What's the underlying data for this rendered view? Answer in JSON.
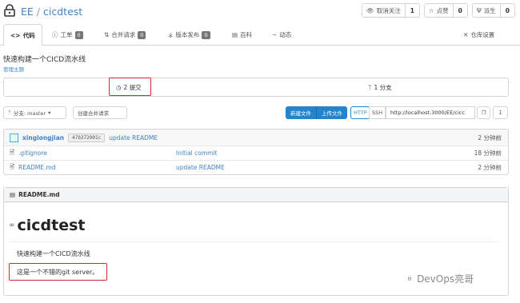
{
  "repo": {
    "owner": "EE",
    "separator": "/",
    "name": "cicdtest"
  },
  "actions": [
    {
      "label": "取消关注",
      "count": "1"
    },
    {
      "label": "点赞",
      "count": "0"
    },
    {
      "label": "派生",
      "count": "0"
    }
  ],
  "tabs": [
    {
      "label": "代码"
    },
    {
      "label": "工单",
      "badge": "0"
    },
    {
      "label": "合并请求",
      "badge": "0"
    },
    {
      "label": "版本发布",
      "badge": "0"
    },
    {
      "label": "百科"
    },
    {
      "label": "动态"
    },
    {
      "label": "仓库设置"
    }
  ],
  "description": "快速构建一个CICD流水线",
  "topics_link": "管理主题",
  "stats": {
    "commits": "2 提交",
    "branches": "1 分支"
  },
  "toolbar": {
    "branch": "分支: master",
    "new_pr": "创建合并请求",
    "new_file": "新建文件",
    "upload": "上传文件",
    "http": "HTTP",
    "ssh": "SSH",
    "clone_url": "http://localhost:3000/EE/cicc"
  },
  "latest_commit": {
    "author": "xinglongjian",
    "sha": "47b372901c",
    "message": "update README",
    "time": "2 分钟前"
  },
  "files": [
    {
      "name": ".gitignore",
      "message": "Initial commit",
      "time": "18 分钟前"
    },
    {
      "name": "README.md",
      "message": "update README",
      "time": "2 分钟前"
    }
  ],
  "readme": {
    "header": "README.md",
    "title": "cicdtest",
    "para1": "快速构建一个CICD流水线",
    "para2": "这是一个不错的git server。"
  },
  "watermark": "DevOps亮哥",
  "colors": {
    "link": "#4183c4",
    "primary_button": "#2185d0",
    "highlight_box": "#db2828"
  }
}
